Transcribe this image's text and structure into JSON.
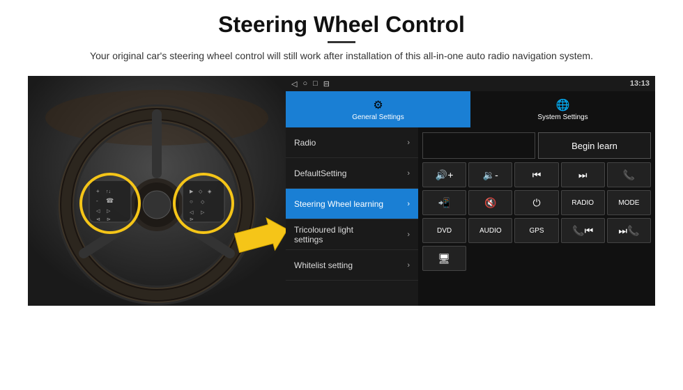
{
  "header": {
    "title": "Steering Wheel Control",
    "divider": true,
    "subtitle": "Your original car's steering wheel control will still work after installation of this all-in-one auto radio navigation system."
  },
  "status_bar": {
    "icons": [
      "◁",
      "○",
      "□",
      "⊟"
    ],
    "right": "13:13",
    "signal_icon": "▾",
    "wifi_icon": "▾",
    "gps_icon": "♦"
  },
  "tabs": [
    {
      "label": "General Settings",
      "icon": "⚙",
      "active": true
    },
    {
      "label": "System Settings",
      "icon": "🌐",
      "active": false
    }
  ],
  "menu": {
    "items": [
      {
        "label": "Radio",
        "active": false
      },
      {
        "label": "DefaultSetting",
        "active": false
      },
      {
        "label": "Steering Wheel learning",
        "active": true
      },
      {
        "label": "Tricoloured light settings",
        "active": false
      },
      {
        "label": "Whitelist setting",
        "active": false
      }
    ]
  },
  "panel": {
    "begin_learn_label": "Begin learn",
    "controls_row1": [
      "🔊+",
      "🔉-",
      "⏮",
      "⏭",
      "📞"
    ],
    "controls_row2": [
      "📞",
      "🔇",
      "⏻",
      "RADIO",
      "MODE"
    ],
    "controls_row3": [
      "DVD",
      "AUDIO",
      "GPS",
      "📞⏮",
      "⏭📞"
    ],
    "controls_row4": [
      "🖥"
    ]
  }
}
